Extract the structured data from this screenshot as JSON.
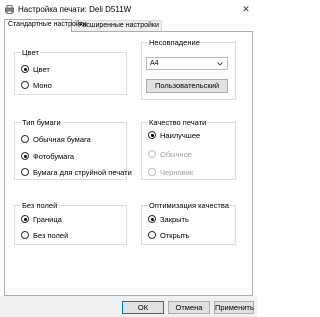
{
  "window": {
    "title": "Настройка печати: Deli D511W",
    "close_glyph": "✕",
    "icon": "printer-icon"
  },
  "tabs": [
    {
      "label": "Стандартные настройки",
      "active": true
    },
    {
      "label": "Расширенные настройки",
      "active": false
    }
  ],
  "groups": {
    "color": {
      "title": "Цвет",
      "options": [
        {
          "label": "Цвет",
          "checked": true
        },
        {
          "label": "Моно",
          "checked": false
        }
      ]
    },
    "paper_size": {
      "title": "Несовпадение",
      "selected": "A4",
      "custom_button": "Пользовательский"
    },
    "paper_type": {
      "title": "Тип бумаги",
      "options": [
        {
          "label": "Обычная бумага",
          "checked": false
        },
        {
          "label": "Фотобумага",
          "checked": true
        },
        {
          "label": "Бумага для струйной печати",
          "checked": false
        }
      ]
    },
    "print_quality": {
      "title": "Качество печати",
      "options": [
        {
          "label": "Наилучшее",
          "checked": true,
          "disabled": false
        },
        {
          "label": "Обычное",
          "checked": false,
          "disabled": true
        },
        {
          "label": "Черновик",
          "checked": false,
          "disabled": true
        }
      ]
    },
    "borderless": {
      "title": "Без полей",
      "options": [
        {
          "label": "Граница",
          "checked": true
        },
        {
          "label": "Без полей",
          "checked": false
        }
      ]
    },
    "quality_optimization": {
      "title": "Оптимизация качества",
      "options": [
        {
          "label": "Закрыть",
          "checked": true
        },
        {
          "label": "Открыть",
          "checked": false
        }
      ]
    }
  },
  "footer": {
    "ok": "ОК",
    "cancel": "Отмена",
    "apply": "Применить"
  }
}
